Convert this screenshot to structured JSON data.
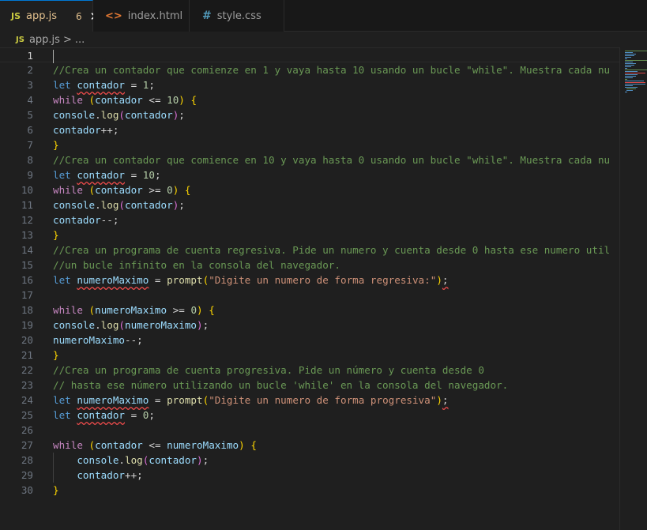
{
  "tabs": [
    {
      "icon": "JS",
      "label": "app.js",
      "problems": "6",
      "close": "✕"
    },
    {
      "icon": "<>",
      "label": "index.html"
    },
    {
      "icon": "#",
      "label": "style.css"
    }
  ],
  "breadcrumb": {
    "icon": "JS",
    "file": "app.js",
    "separator": ">",
    "more": "..."
  },
  "colors": {
    "accent": "#0078d4",
    "modified_tab": "#e2c08d",
    "error_squiggle": "#f14c4c"
  },
  "lines": [
    {
      "n": "1"
    },
    {
      "n": "2",
      "t": {
        "c1": "//Crea un contador que comienze en 1 y vaya hasta 10 usando un bucle \"while\". Muestra cada nu"
      }
    },
    {
      "n": "3",
      "t": {
        "k": "let",
        "v": "contador",
        "o": " = ",
        "num": "1",
        "e": ";"
      }
    },
    {
      "n": "4",
      "t": {
        "k": "while",
        "sp": " ",
        "b1": "(",
        "v": "contador",
        "o": " <= ",
        "num": "10",
        "b2": ")",
        "sp2": " ",
        "b3": "{"
      }
    },
    {
      "n": "5",
      "t": {
        "v": "console",
        "d": ".",
        "f": "log",
        "b1": "(",
        "v2": "contador",
        "b2": ")",
        "e": ";"
      }
    },
    {
      "n": "6",
      "t": {
        "v": "contador",
        "o": "++;"
      }
    },
    {
      "n": "7",
      "t": {
        "b1": "}"
      }
    },
    {
      "n": "8",
      "t": {
        "c1": "//Crea un contador que comience en 10 y vaya hasta 0 usando un bucle \"while\". Muestra cada nu"
      }
    },
    {
      "n": "9",
      "t": {
        "k": "let",
        "v": "contador",
        "o": " = ",
        "num": "10",
        "e": ";"
      }
    },
    {
      "n": "10",
      "t": {
        "k": "while",
        "sp": " ",
        "b1": "(",
        "v": "contador",
        "o": " >= ",
        "num": "0",
        "b2": ")",
        "sp2": " ",
        "b3": "{"
      }
    },
    {
      "n": "11",
      "t": {
        "v": "console",
        "d": ".",
        "f": "log",
        "b1": "(",
        "v2": "contador",
        "b2": ")",
        "e": ";"
      }
    },
    {
      "n": "12",
      "t": {
        "v": "contador",
        "o": "--;"
      }
    },
    {
      "n": "13",
      "t": {
        "b1": "}"
      }
    },
    {
      "n": "14",
      "t": {
        "c1": "//Crea un programa de cuenta regresiva. Pide un numero y cuenta desde 0 hasta ese numero util"
      }
    },
    {
      "n": "15",
      "t": {
        "c1": "//un bucle infinito en la consola del navegador."
      }
    },
    {
      "n": "16",
      "t": {
        "k": "let",
        "v": "numeroMaximo",
        "o": " = ",
        "f": "prompt",
        "b1": "(",
        "s": "\"Digite un numero de forma regresiva:\"",
        "b2": ")",
        "e": ";"
      }
    },
    {
      "n": "17"
    },
    {
      "n": "18",
      "t": {
        "k": "while",
        "sp": " ",
        "b1": "(",
        "v": "numeroMaximo",
        "o": " >= ",
        "num": "0",
        "b2": ")",
        "sp2": " ",
        "b3": "{"
      }
    },
    {
      "n": "19",
      "t": {
        "v": "console",
        "d": ".",
        "f": "log",
        "b1": "(",
        "v2": "numeroMaximo",
        "b2": ")",
        "e": ";"
      }
    },
    {
      "n": "20",
      "t": {
        "v": "numeroMaximo",
        "o": "--;"
      }
    },
    {
      "n": "21",
      "t": {
        "b1": "}"
      }
    },
    {
      "n": "22",
      "t": {
        "c1": "//Crea un programa de cuenta progresiva. Pide un número y cuenta desde 0"
      }
    },
    {
      "n": "23",
      "t": {
        "c1": "// hasta ese número utilizando un bucle 'while' en la consola del navegador."
      }
    },
    {
      "n": "24",
      "t": {
        "k": "let",
        "v": "numeroMaximo",
        "o": " = ",
        "f": "prompt",
        "b1": "(",
        "s": "\"Digite un numero de forma progresiva\"",
        "b2": ")",
        "e": ";"
      }
    },
    {
      "n": "25",
      "t": {
        "k": "let",
        "v": "contador",
        "o": " = ",
        "num": "0",
        "e": ";"
      }
    },
    {
      "n": "26"
    },
    {
      "n": "27",
      "t": {
        "k": "while",
        "sp": " ",
        "b1": "(",
        "v": "contador",
        "o": " <= ",
        "v3": "numeroMaximo",
        "b2": ")",
        "sp2": " ",
        "b3": "{"
      }
    },
    {
      "n": "28",
      "t": {
        "ind": "    ",
        "v": "console",
        "d": ".",
        "f": "log",
        "b1": "(",
        "v2": "contador",
        "b2": ")",
        "e": ";"
      }
    },
    {
      "n": "29",
      "t": {
        "ind": "    ",
        "v": "contador",
        "o": "++;"
      }
    },
    {
      "n": "30",
      "t": {
        "b1": "}"
      }
    }
  ]
}
